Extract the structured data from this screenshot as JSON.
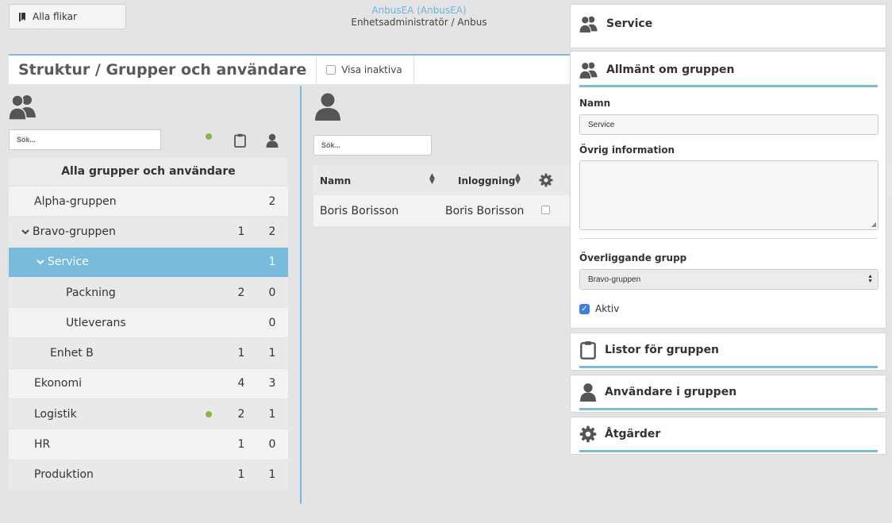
{
  "top": {
    "all_tabs_label": "Alla flikar",
    "user_name": "AnbusEA (AnbusEA)",
    "user_role": "Enhetsadministratör / Anbus"
  },
  "title_bar": {
    "title": "Struktur / Grupper och användare",
    "show_inactive_label": "Visa inaktiva"
  },
  "groups": {
    "search_placeholder": "Sök...",
    "header": "Alla grupper och användare",
    "rows": [
      {
        "label": "Alpha-gruppen",
        "n1": "",
        "n2": "2"
      },
      {
        "label": "Bravo-gruppen",
        "n1": "1",
        "n2": "2"
      },
      {
        "label": "Service",
        "n1": "",
        "n2": "1"
      },
      {
        "label": "Packning",
        "n1": "2",
        "n2": "0"
      },
      {
        "label": "Utleverans",
        "n1": "",
        "n2": "0"
      },
      {
        "label": "Enhet B",
        "n1": "1",
        "n2": "1"
      },
      {
        "label": "Ekonomi",
        "n1": "4",
        "n2": "3"
      },
      {
        "label": "Logistik",
        "n1": "2",
        "n2": "1"
      },
      {
        "label": "HR",
        "n1": "1",
        "n2": "0"
      },
      {
        "label": "Produktion",
        "n1": "1",
        "n2": "1"
      }
    ]
  },
  "users": {
    "search_placeholder": "Sök...",
    "columns": {
      "name": "Namn",
      "login": "Inloggning"
    },
    "rows": [
      {
        "name": "Boris Borisson",
        "login": "Boris Borisson"
      }
    ]
  },
  "details": {
    "service_title": "Service",
    "general_title": "Allmänt om gruppen",
    "name_label": "Namn",
    "name_value": "Service",
    "other_info_label": "Övrig information",
    "other_info_value": "",
    "parent_label": "Överliggande grupp",
    "parent_value": "Bravo-gruppen",
    "active_label": "Aktiv",
    "lists_title": "Listor för gruppen",
    "users_title": "Användare i gruppen",
    "actions_title": "Åtgärder"
  },
  "colors": {
    "accent": "#78bbdc",
    "status_dot": "#8ab54a",
    "checkbox": "#3d7fe0"
  }
}
